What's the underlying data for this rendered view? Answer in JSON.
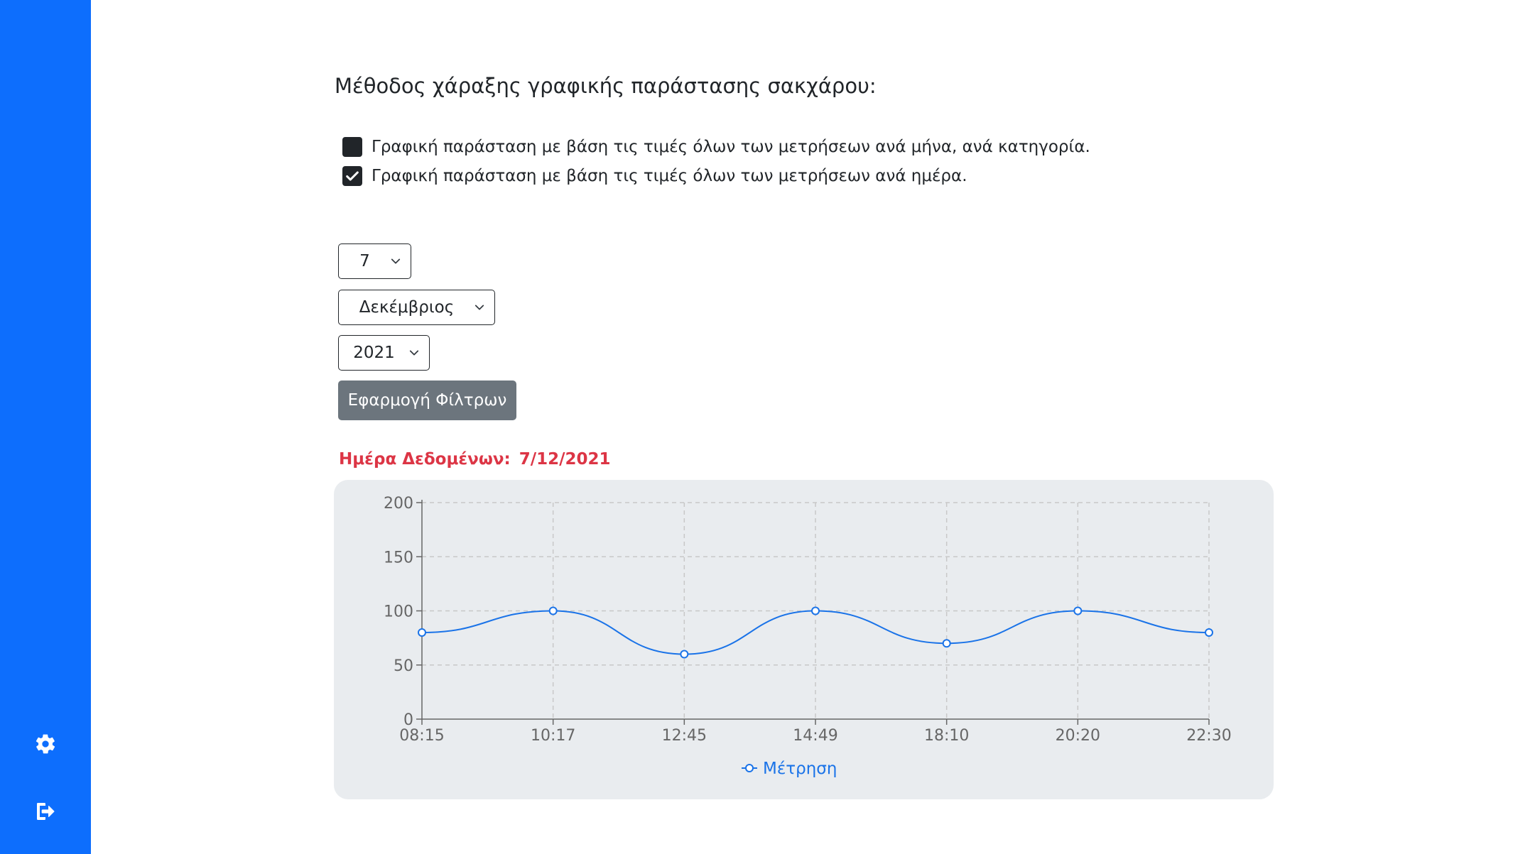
{
  "sidebar": {
    "icons": [
      "gear-icon",
      "sign-out-icon"
    ],
    "color": "#0d6efd"
  },
  "heading": "Μέθοδος χάραξης γραφικής παράστασης σακχάρου:",
  "options": [
    {
      "label": "Γραφική παράσταση με βάση τις τιμές όλων των μετρήσεων ανά μήνα, ανά κατηγορία.",
      "checked": false
    },
    {
      "label": "Γραφική παράσταση με βάση τις τιμές όλων των μετρήσεων ανά ημέρα.",
      "checked": true
    }
  ],
  "filters": {
    "day": "7",
    "month": "Δεκέμβριος",
    "year": "2021",
    "apply_label": "Εφαρμογή Φίλτρων"
  },
  "data_day": {
    "label": "Ημέρα Δεδομένων:",
    "value": "7/12/2021",
    "color": "#dc3545"
  },
  "chart_data": {
    "type": "line",
    "categories": [
      "08:15",
      "10:17",
      "12:45",
      "14:49",
      "18:10",
      "20:20",
      "22:30"
    ],
    "series": [
      {
        "name": "Μέτρηση",
        "values": [
          80,
          100,
          60,
          100,
          70,
          100,
          80
        ]
      }
    ],
    "ylim": [
      0,
      200
    ],
    "yticks": [
      0,
      50,
      100,
      150,
      200
    ],
    "grid": true,
    "legend": "bottom",
    "line_color": "#1a73e8"
  }
}
